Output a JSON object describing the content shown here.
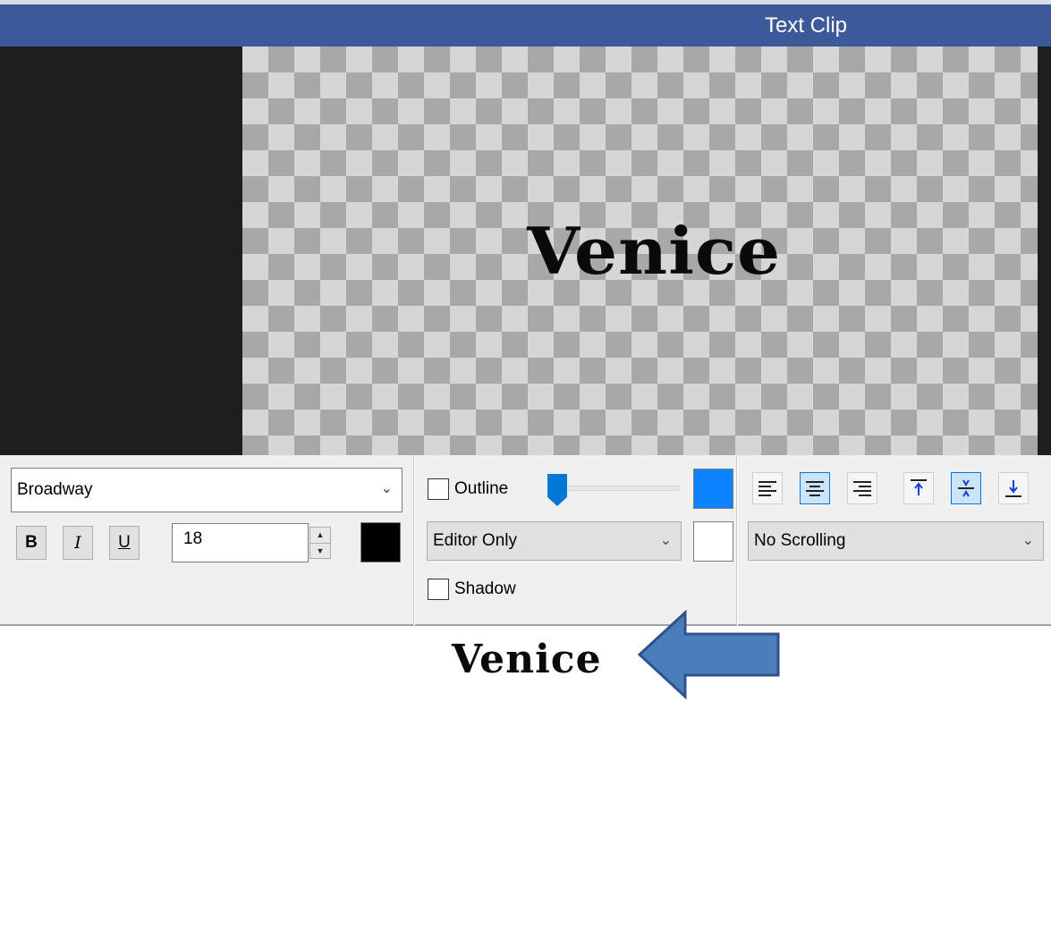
{
  "window": {
    "title": "Text Clip"
  },
  "preview": {
    "text": "Venice"
  },
  "font": {
    "name": "Broadway",
    "size": "18",
    "color": "#000000"
  },
  "format": {
    "bold_label": "B",
    "italic_label": "I",
    "underline_label": "U"
  },
  "outline": {
    "label": "Outline",
    "checked": false,
    "color": "#0a84ff",
    "slider_level": 0.05
  },
  "display_mode": {
    "value": "Editor Only"
  },
  "shadow": {
    "label": "Shadow",
    "checked": false,
    "color": "#ffffff"
  },
  "alignment": {
    "horizontal": [
      "align-left",
      "align-center",
      "align-right"
    ],
    "horizontal_selected": "align-center",
    "vertical": [
      "align-top",
      "align-middle",
      "align-bottom"
    ],
    "vertical_selected": "align-middle"
  },
  "scrolling": {
    "value": "No Scrolling"
  },
  "result": {
    "text": "Venice"
  },
  "annotation": {
    "arrow_color": "#4a7ebb"
  }
}
